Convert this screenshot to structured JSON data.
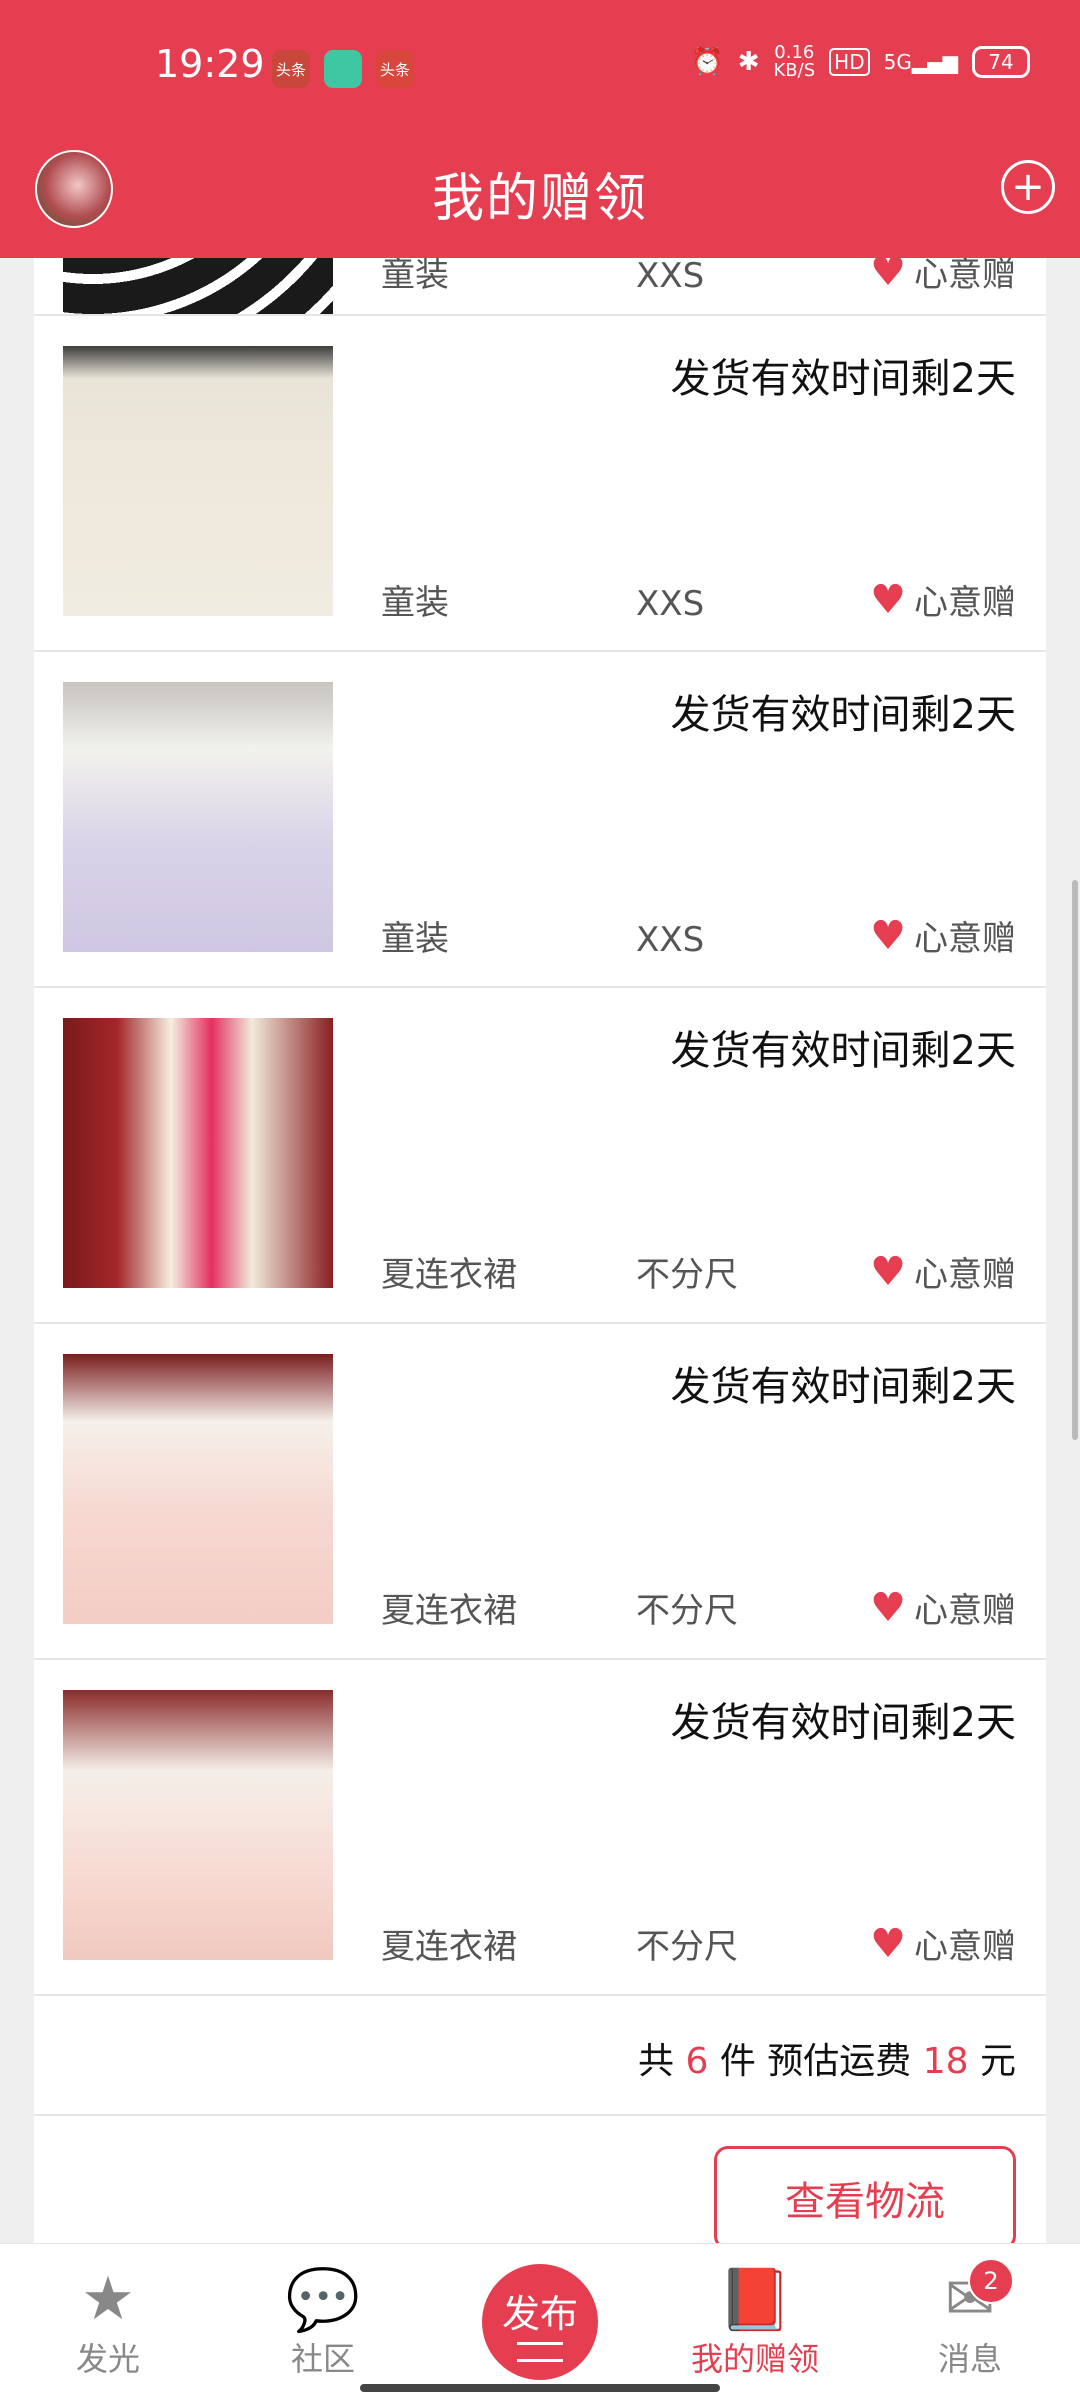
{
  "status_bar": {
    "time": "19:29",
    "apps": [
      "头条",
      "",
      "头条"
    ],
    "net_speed_value": "0.16",
    "net_speed_unit": "KB/S",
    "hd": "HD",
    "network": "5G",
    "battery": "74"
  },
  "header": {
    "title": "我的赠领",
    "add_icon": "plus-circle-icon"
  },
  "items": [
    {
      "category": "童装",
      "size": "XXS",
      "gift_type": "心意赠",
      "expire": ""
    },
    {
      "category": "童装",
      "size": "XXS",
      "gift_type": "心意赠",
      "expire": "发货有效时间剩2天"
    },
    {
      "category": "童装",
      "size": "XXS",
      "gift_type": "心意赠",
      "expire": "发货有效时间剩2天"
    },
    {
      "category": "夏连衣裙",
      "size": "不分尺",
      "gift_type": "心意赠",
      "expire": "发货有效时间剩2天"
    },
    {
      "category": "夏连衣裙",
      "size": "不分尺",
      "gift_type": "心意赠",
      "expire": "发货有效时间剩2天"
    },
    {
      "category": "夏连衣裙",
      "size": "不分尺",
      "gift_type": "心意赠",
      "expire": "发货有效时间剩2天"
    }
  ],
  "summary": {
    "prefix": "共",
    "count": "6",
    "mid": "件 预估运费",
    "fee": "18",
    "suffix": "元"
  },
  "logistics_button": "查看物流",
  "nav": {
    "items": [
      {
        "label": "发光",
        "icon": "star-icon"
      },
      {
        "label": "社区",
        "icon": "chat-bubble-icon"
      },
      {
        "label": "发布",
        "icon": "publish-icon"
      },
      {
        "label": "我的赠领",
        "icon": "gift-book-icon"
      },
      {
        "label": "消息",
        "icon": "mail-icon"
      }
    ],
    "message_badge": "2"
  },
  "colors": {
    "accent": "#e63e51"
  }
}
